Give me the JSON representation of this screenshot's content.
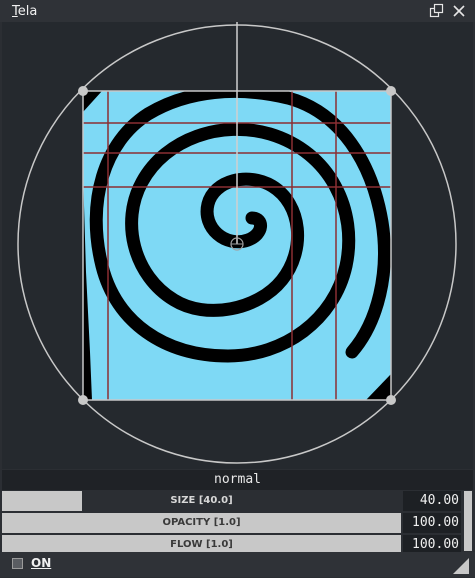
{
  "window": {
    "title": "Tela"
  },
  "icons": {
    "float": "float-window-icon",
    "close": "close-icon",
    "grip": "resize-grip-icon"
  },
  "canvas": {
    "fill_color": "#7ed9f5",
    "guide_color": "#8b2f33",
    "circle_color": "#c8c8c8",
    "stroke_color": "#000000"
  },
  "brush": {
    "blend_mode": "normal",
    "sliders": [
      {
        "id": "size",
        "label": "SIZE [40.0]",
        "value": "40.00",
        "fill_fraction": 0.2
      },
      {
        "id": "opacity",
        "label": "OPACITY [1.0]",
        "value": "100.00",
        "fill_fraction": 1.0
      },
      {
        "id": "flow",
        "label": "FLOW [1.0]",
        "value": "100.00",
        "fill_fraction": 1.0
      }
    ]
  },
  "footer": {
    "toggle_label": "ON",
    "checked": false
  }
}
